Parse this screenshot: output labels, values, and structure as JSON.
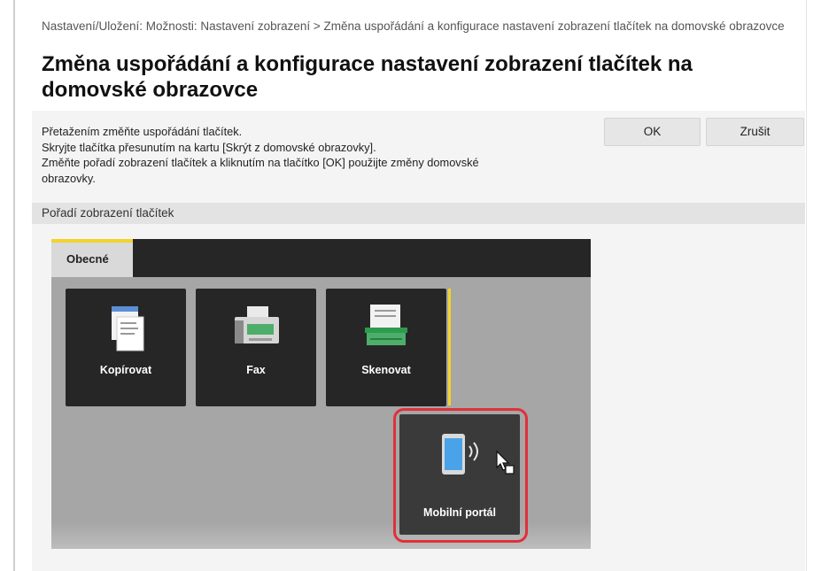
{
  "breadcrumb": "Nastavení/Uložení: Možnosti: Nastavení zobrazení > Změna uspořádání a konfigurace nastavení zobrazení tlačítek na domovské obrazovce",
  "title": "Změna uspořádání a konfigurace nastavení zobrazení tlačítek na domovské obrazovce",
  "description": [
    "Přetažením změňte uspořádání tlačítek.",
    "Skryjte tlačítka přesunutím na kartu [Skrýt z domovské obrazovky].",
    "Změňte pořadí zobrazení tlačítek a kliknutím na tlačítko [OK] použijte změny domovské",
    "obrazovky."
  ],
  "buttons": {
    "ok": "OK",
    "cancel": "Zrušit"
  },
  "section_label": "Pořadí zobrazení tlačítek",
  "tab_label": "Obecné",
  "tiles": [
    {
      "label": "Kopírovat",
      "icon": "copy-icon"
    },
    {
      "label": "Fax",
      "icon": "fax-icon"
    },
    {
      "label": "Skenovat",
      "icon": "scan-icon"
    }
  ],
  "drag_tile": {
    "label": "Mobilní portál",
    "icon": "mobile-portal-icon"
  },
  "colors": {
    "accent_yellow": "#f2d32a",
    "highlight_red": "#e0303a",
    "tile_bg": "#262626",
    "panel_bg": "#a6a6a6"
  }
}
